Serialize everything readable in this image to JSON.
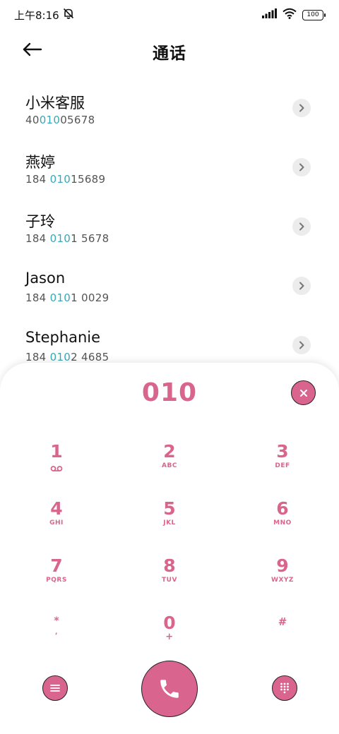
{
  "status_bar": {
    "time": "上午8:16",
    "battery": "100",
    "icons": [
      "muted-bell-icon",
      "signal-icon",
      "wifi-icon",
      "battery-icon"
    ]
  },
  "header": {
    "title": "通话",
    "back_icon": "back-arrow-icon"
  },
  "contacts": [
    {
      "name": "小米客服",
      "number_pre": "40",
      "number_match": "010",
      "number_post": "05678"
    },
    {
      "name": "燕婷",
      "number_pre": "184 ",
      "number_match": "010",
      "number_post": "15689"
    },
    {
      "name": "子玲",
      "number_pre": "184 ",
      "number_match": "010",
      "number_post": "1 5678"
    },
    {
      "name": "Jason",
      "number_pre": "184 ",
      "number_match": "010",
      "number_post": "1 0029"
    },
    {
      "name": "Stephanie",
      "number_pre": "184 ",
      "number_match": "010",
      "number_post": "2 4685"
    }
  ],
  "dialer": {
    "input": "010",
    "keys": [
      {
        "digit": "1",
        "sub": "",
        "icon": "voicemail-icon"
      },
      {
        "digit": "2",
        "sub": "ABC"
      },
      {
        "digit": "3",
        "sub": "DEF"
      },
      {
        "digit": "4",
        "sub": "GHI"
      },
      {
        "digit": "5",
        "sub": "JKL"
      },
      {
        "digit": "6",
        "sub": "MNO"
      },
      {
        "digit": "7",
        "sub": "PQRS"
      },
      {
        "digit": "8",
        "sub": "TUV"
      },
      {
        "digit": "9",
        "sub": "WXYZ"
      },
      {
        "digit": "*",
        "sub": ","
      },
      {
        "digit": "0",
        "sub": "+"
      },
      {
        "digit": "#",
        "sub": ""
      }
    ]
  },
  "colors": {
    "accent": "#d9658f",
    "match_highlight": "#35a9b8"
  }
}
